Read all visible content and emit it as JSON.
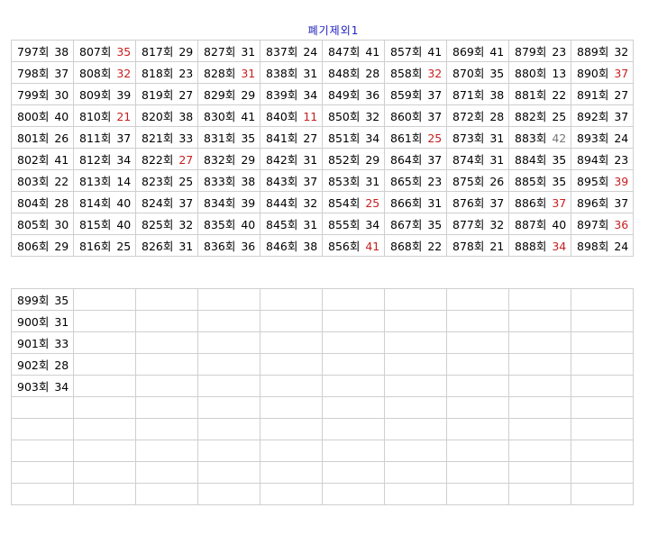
{
  "title": "폐기제외1",
  "colors": {
    "highlight": "#c81e1e",
    "muted": "#777777",
    "title": "#2020c0"
  },
  "top_table": {
    "rows": [
      [
        [
          "797회",
          "38",
          ""
        ],
        [
          "807회",
          "35",
          "red"
        ],
        [
          "817회",
          "29",
          ""
        ],
        [
          "827회",
          "31",
          ""
        ],
        [
          "837회",
          "24",
          ""
        ],
        [
          "847회",
          "41",
          ""
        ],
        [
          "857회",
          "41",
          ""
        ],
        [
          "869회",
          "41",
          ""
        ],
        [
          "879회",
          "23",
          ""
        ],
        [
          "889회",
          "32",
          ""
        ]
      ],
      [
        [
          "798회",
          "37",
          ""
        ],
        [
          "808회",
          "32",
          "red"
        ],
        [
          "818회",
          "23",
          ""
        ],
        [
          "828회",
          "31",
          "red"
        ],
        [
          "838회",
          "31",
          ""
        ],
        [
          "848회",
          "28",
          ""
        ],
        [
          "858회",
          "32",
          "red"
        ],
        [
          "870회",
          "35",
          ""
        ],
        [
          "880회",
          "13",
          ""
        ],
        [
          "890회",
          "37",
          "red"
        ]
      ],
      [
        [
          "799회",
          "30",
          ""
        ],
        [
          "809회",
          "39",
          ""
        ],
        [
          "819회",
          "27",
          ""
        ],
        [
          "829회",
          "29",
          ""
        ],
        [
          "839회",
          "34",
          ""
        ],
        [
          "849회",
          "36",
          ""
        ],
        [
          "859회",
          "37",
          ""
        ],
        [
          "871회",
          "38",
          ""
        ],
        [
          "881회",
          "22",
          ""
        ],
        [
          "891회",
          "27",
          ""
        ]
      ],
      [
        [
          "800회",
          "40",
          ""
        ],
        [
          "810회",
          "21",
          "red"
        ],
        [
          "820회",
          "38",
          ""
        ],
        [
          "830회",
          "41",
          ""
        ],
        [
          "840회",
          "11",
          "red"
        ],
        [
          "850회",
          "32",
          ""
        ],
        [
          "860회",
          "37",
          ""
        ],
        [
          "872회",
          "28",
          ""
        ],
        [
          "882회",
          "25",
          ""
        ],
        [
          "892회",
          "37",
          ""
        ]
      ],
      [
        [
          "801회",
          "26",
          ""
        ],
        [
          "811회",
          "37",
          ""
        ],
        [
          "821회",
          "33",
          ""
        ],
        [
          "831회",
          "35",
          ""
        ],
        [
          "841회",
          "27",
          ""
        ],
        [
          "851회",
          "34",
          ""
        ],
        [
          "861회",
          "25",
          "red"
        ],
        [
          "873회",
          "31",
          ""
        ],
        [
          "883회",
          "42",
          "gray"
        ],
        [
          "893회",
          "24",
          ""
        ]
      ],
      [
        [
          "802회",
          "41",
          ""
        ],
        [
          "812회",
          "34",
          ""
        ],
        [
          "822회",
          "27",
          "red"
        ],
        [
          "832회",
          "29",
          ""
        ],
        [
          "842회",
          "31",
          ""
        ],
        [
          "852회",
          "29",
          ""
        ],
        [
          "864회",
          "37",
          ""
        ],
        [
          "874회",
          "31",
          ""
        ],
        [
          "884회",
          "35",
          ""
        ],
        [
          "894회",
          "23",
          ""
        ]
      ],
      [
        [
          "803회",
          "22",
          ""
        ],
        [
          "813회",
          "14",
          ""
        ],
        [
          "823회",
          "25",
          ""
        ],
        [
          "833회",
          "38",
          ""
        ],
        [
          "843회",
          "37",
          ""
        ],
        [
          "853회",
          "31",
          ""
        ],
        [
          "865회",
          "23",
          ""
        ],
        [
          "875회",
          "26",
          ""
        ],
        [
          "885회",
          "35",
          ""
        ],
        [
          "895회",
          "39",
          "red"
        ]
      ],
      [
        [
          "804회",
          "28",
          ""
        ],
        [
          "814회",
          "40",
          ""
        ],
        [
          "824회",
          "37",
          ""
        ],
        [
          "834회",
          "39",
          ""
        ],
        [
          "844회",
          "32",
          ""
        ],
        [
          "854회",
          "25",
          "red"
        ],
        [
          "866회",
          "31",
          ""
        ],
        [
          "876회",
          "37",
          ""
        ],
        [
          "886회",
          "37",
          "red"
        ],
        [
          "896회",
          "37",
          ""
        ]
      ],
      [
        [
          "805회",
          "30",
          ""
        ],
        [
          "815회",
          "40",
          ""
        ],
        [
          "825회",
          "32",
          ""
        ],
        [
          "835회",
          "40",
          ""
        ],
        [
          "845회",
          "31",
          ""
        ],
        [
          "855회",
          "34",
          ""
        ],
        [
          "867회",
          "35",
          ""
        ],
        [
          "877회",
          "32",
          ""
        ],
        [
          "887회",
          "40",
          ""
        ],
        [
          "897회",
          "36",
          "red"
        ]
      ],
      [
        [
          "806회",
          "29",
          ""
        ],
        [
          "816회",
          "25",
          ""
        ],
        [
          "826회",
          "31",
          ""
        ],
        [
          "836회",
          "36",
          ""
        ],
        [
          "846회",
          "38",
          ""
        ],
        [
          "856회",
          "41",
          "red"
        ],
        [
          "868회",
          "22",
          ""
        ],
        [
          "878회",
          "21",
          ""
        ],
        [
          "888회",
          "34",
          "red"
        ],
        [
          "898회",
          "24",
          ""
        ]
      ]
    ]
  },
  "bottom_table": {
    "rows": [
      [
        [
          "899회",
          "35",
          ""
        ]
      ],
      [
        [
          "900회",
          "31",
          ""
        ]
      ],
      [
        [
          "901회",
          "33",
          ""
        ]
      ],
      [
        [
          "902회",
          "28",
          ""
        ]
      ],
      [
        [
          "903회",
          "34",
          ""
        ]
      ]
    ],
    "total_rows": 10,
    "total_cols": 10
  }
}
